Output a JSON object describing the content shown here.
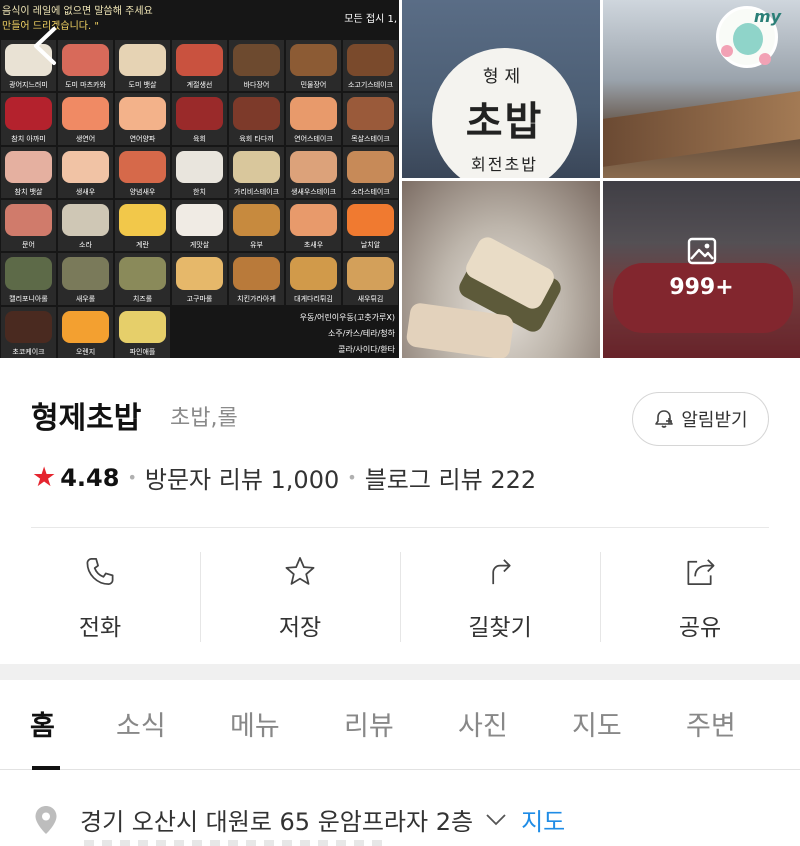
{
  "gallery": {
    "menu_board": {
      "notice_line1": "음식이 레일에 없으면 말씀해 주세요",
      "notice_line2": "만들어 드리겠습니다. \"",
      "all_plates": "모든 접시 1,",
      "items": [
        "광어지느러미",
        "도미 마츠카와",
        "도미 뱃살",
        "계절생선",
        "바다장어",
        "민물장어",
        "소고기스테이크",
        "참치 아까미",
        "생연어",
        "연어양파",
        "육회",
        "육회 타다끼",
        "연어스테이크",
        "목살스테이크",
        "참치 뱃살",
        "생새우",
        "양념새우",
        "한치",
        "가리비스테이크",
        "생새우스테이크",
        "소라스테이크",
        "문어",
        "소라",
        "계란",
        "게맛살",
        "유부",
        "초새우",
        "날치알",
        "캘리포니아롤",
        "새우롤",
        "치즈롤",
        "고구마롤",
        "치킨가라아게",
        "대게다리튀김",
        "새우튀김",
        "초코케이크",
        "오렌지",
        "파인애플"
      ],
      "extra_lines": [
        "우동/어린이우동(고춧가루X)",
        "소주/카스/테라/청하",
        "콜라/사이다/환타"
      ]
    },
    "sign": {
      "line1": "형제",
      "line2": "초밥",
      "line3": "회전초밥"
    },
    "my_badge": "my",
    "photo_count": "999+"
  },
  "place": {
    "name": "형제초밥",
    "category": "초밥,롤",
    "notify_label": "알림받기",
    "rating": "4.48",
    "visitor_reviews": "방문자 리뷰 1,000",
    "blog_reviews": "블로그 리뷰 222"
  },
  "actions": [
    {
      "label": "전화",
      "icon": "phone-icon"
    },
    {
      "label": "저장",
      "icon": "star-icon"
    },
    {
      "label": "길찾기",
      "icon": "directions-icon"
    },
    {
      "label": "공유",
      "icon": "share-icon"
    }
  ],
  "tabs": [
    "홈",
    "소식",
    "메뉴",
    "리뷰",
    "사진",
    "지도",
    "주변"
  ],
  "address": {
    "text": "경기 오산시 대원로 65 운암프라자 2층",
    "map_link": "지도"
  },
  "colors": {
    "star": "#e5252f",
    "link": "#1f8ce6",
    "active_tab": "#111111"
  }
}
